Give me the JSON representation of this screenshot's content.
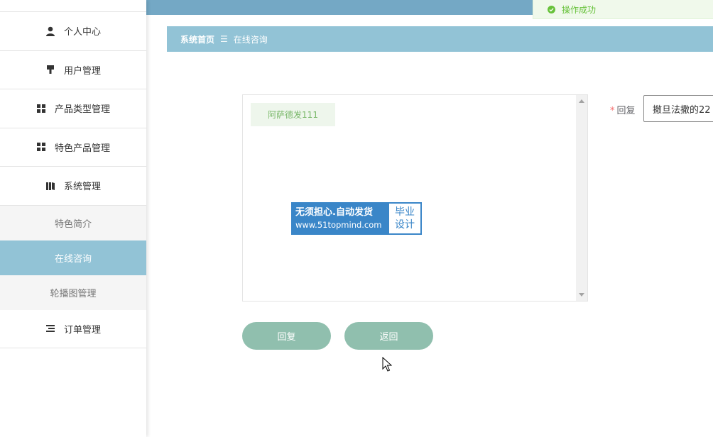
{
  "toast": {
    "text": "操作成功",
    "icon": "check-circle-icon",
    "color": "#67c23a"
  },
  "breadcrumb": {
    "home": "系统首页",
    "separator": "☰",
    "current": "在线咨询"
  },
  "sidebar": {
    "items": [
      {
        "label": "个人中心",
        "icon": "user-icon"
      },
      {
        "label": "用户管理",
        "icon": "pin-icon"
      },
      {
        "label": "产品类型管理",
        "icon": "grid-icon"
      },
      {
        "label": "特色产品管理",
        "icon": "grid-icon"
      },
      {
        "label": "系统管理",
        "icon": "book-icon"
      }
    ],
    "submenu": [
      {
        "label": "特色简介"
      },
      {
        "label": "在线咨询",
        "active": true
      },
      {
        "label": "轮播图管理"
      }
    ],
    "last": {
      "label": "订单管理",
      "icon": "list-icon"
    }
  },
  "chat": {
    "message": "阿萨德发111"
  },
  "reply": {
    "label": "回复",
    "value": "撤旦法撒的22"
  },
  "buttons": {
    "reply": "回复",
    "back": "返回"
  },
  "watermark": {
    "line1": "无须担心.自动发货",
    "line2": "www.51topmind.com",
    "right1": "毕业",
    "right2": "设计"
  },
  "colors": {
    "sidebar_active": "#92c3d6",
    "topbar": "#74a8c5",
    "button": "#90bfae"
  }
}
